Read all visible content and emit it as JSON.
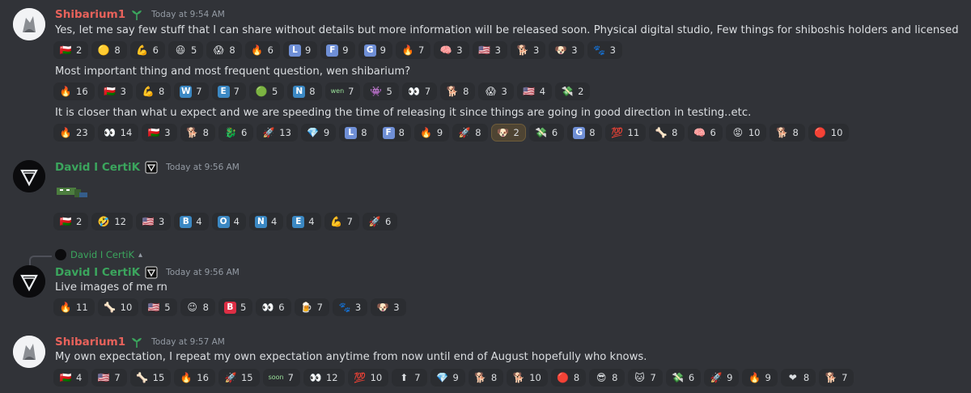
{
  "colors": {
    "background": "#313338",
    "shib_name": "#e8625b",
    "certik_name": "#3ba55d",
    "reaction_bg": "#2b2d31",
    "reaction_active": "#4e4433",
    "timestamp": "#949ba4"
  },
  "messages": [
    {
      "author": "Shibarium1",
      "timestamp": "Today at 9:54 AM",
      "blocks": [
        {
          "text": "Yes, let me say few stuff that I can share without details but more information will be released soon. Physical digital studio, Few things for shiboshis holders and licensed something.",
          "reactions": [
            {
              "icon": "flag-oman",
              "emoji": "🇴🇲",
              "count": "2"
            },
            {
              "icon": "yellow-circle",
              "emoji": "🟡",
              "count": "8"
            },
            {
              "icon": "muscle",
              "emoji": "💪",
              "count": "6"
            },
            {
              "icon": "laugh",
              "emoji": "😆",
              "count": "5"
            },
            {
              "icon": "scream",
              "emoji": "😱",
              "count": "8"
            },
            {
              "icon": "fire-hand",
              "emoji": "🔥",
              "count": "6"
            },
            {
              "icon": "letter-l",
              "letter": "L",
              "count": "9"
            },
            {
              "icon": "letter-f",
              "letter": "F",
              "count": "9"
            },
            {
              "icon": "letter-g",
              "letter": "G",
              "count": "9"
            },
            {
              "icon": "fire",
              "emoji": "🔥",
              "count": "7"
            },
            {
              "icon": "brain",
              "emoji": "🧠",
              "count": "3"
            },
            {
              "icon": "flag-us",
              "emoji": "🇺🇸",
              "count": "3"
            },
            {
              "icon": "shiba-face",
              "emoji": "🐕",
              "count": "3"
            },
            {
              "icon": "doge-face",
              "emoji": "🐶",
              "count": "3"
            },
            {
              "icon": "shiba-custom",
              "emoji": "🐾",
              "count": "3"
            }
          ]
        },
        {
          "text": "Most important thing and most frequent question, wen shibarium?",
          "reactions": [
            {
              "icon": "fire",
              "emoji": "🔥",
              "count": "16"
            },
            {
              "icon": "flag-oman",
              "emoji": "🇴🇲",
              "count": "3"
            },
            {
              "icon": "muscle",
              "emoji": "💪",
              "count": "8"
            },
            {
              "icon": "letter-w",
              "letter": "W",
              "count": "7"
            },
            {
              "icon": "letter-e",
              "letter": "E",
              "count": "7"
            },
            {
              "icon": "green-blob",
              "emoji": "🟢",
              "count": "5"
            },
            {
              "icon": "letter-n",
              "letter": "N",
              "count": "8"
            },
            {
              "icon": "wen-custom",
              "wen": "wen",
              "count": "7"
            },
            {
              "icon": "robot-custom",
              "emoji": "👾",
              "count": "5"
            },
            {
              "icon": "eyes",
              "emoji": "👀",
              "count": "7"
            },
            {
              "icon": "shiba-custom",
              "emoji": "🐕",
              "count": "8"
            },
            {
              "icon": "scream",
              "emoji": "😱",
              "count": "3"
            },
            {
              "icon": "flag-us",
              "emoji": "🇺🇸",
              "count": "4"
            },
            {
              "icon": "money-custom",
              "emoji": "💸",
              "count": "2"
            }
          ]
        },
        {
          "text": "It is closer than what u expect and we are speeding the time of releasing it since things are going in good direction in testing..etc.",
          "reactions": [
            {
              "icon": "fire-hand",
              "emoji": "🔥",
              "count": "23"
            },
            {
              "icon": "eyes",
              "emoji": "👀",
              "count": "14"
            },
            {
              "icon": "flag-oman",
              "emoji": "🇴🇲",
              "count": "3"
            },
            {
              "icon": "shiba-custom",
              "emoji": "🐕",
              "count": "8"
            },
            {
              "icon": "dragon-custom",
              "emoji": "🐉",
              "count": "6"
            },
            {
              "icon": "rocket",
              "emoji": "🚀",
              "count": "13"
            },
            {
              "icon": "gem",
              "emoji": "💎",
              "count": "9"
            },
            {
              "icon": "letter-l",
              "letter": "L",
              "count": "8"
            },
            {
              "icon": "letter-f",
              "letter": "F",
              "count": "8"
            },
            {
              "icon": "fire",
              "emoji": "🔥",
              "count": "9"
            },
            {
              "icon": "rocket-green",
              "emoji": "🚀",
              "count": "8"
            },
            {
              "icon": "shiba-king",
              "emoji": "🐶",
              "count": "2",
              "active": true
            },
            {
              "icon": "money-custom",
              "emoji": "💸",
              "count": "6"
            },
            {
              "icon": "letter-g",
              "letter": "G",
              "count": "8"
            },
            {
              "icon": "hundred",
              "emoji": "💯",
              "count": "11"
            },
            {
              "icon": "bone",
              "emoji": "🦴",
              "count": "8"
            },
            {
              "icon": "brain",
              "emoji": "🧠",
              "count": "6"
            },
            {
              "icon": "red-face",
              "emoji": "😡",
              "count": "10"
            },
            {
              "icon": "shiba-red",
              "emoji": "🐕",
              "count": "8"
            },
            {
              "icon": "red-token",
              "emoji": "🔴",
              "count": "10"
            }
          ]
        }
      ]
    },
    {
      "author": "David I CertiK",
      "timestamp": "Today at 9:56 AM",
      "reactions": [
        {
          "icon": "flag-oman",
          "emoji": "🇴🇲",
          "count": "2"
        },
        {
          "icon": "rofl",
          "emoji": "🤣",
          "count": "12"
        },
        {
          "icon": "flag-us",
          "emoji": "🇺🇸",
          "count": "3"
        },
        {
          "icon": "letter-b",
          "letter": "B",
          "count": "4"
        },
        {
          "icon": "letter-o",
          "letter": "O",
          "count": "4"
        },
        {
          "icon": "letter-n",
          "letter": "N",
          "count": "4"
        },
        {
          "icon": "letter-e",
          "letter": "E",
          "count": "4"
        },
        {
          "icon": "muscle",
          "emoji": "💪",
          "count": "7"
        },
        {
          "icon": "rocket-green",
          "emoji": "🚀",
          "count": "6"
        }
      ]
    },
    {
      "reply_to": "David I CertiK",
      "author": "David I CertiK",
      "timestamp": "Today at 9:56 AM",
      "text": "Live images of me rn",
      "reactions": [
        {
          "icon": "fire",
          "emoji": "🔥",
          "count": "11"
        },
        {
          "icon": "bone",
          "emoji": "🦴",
          "count": "10"
        },
        {
          "icon": "flag-us",
          "emoji": "🇺🇸",
          "count": "5"
        },
        {
          "icon": "wink",
          "emoji": "😉",
          "count": "8"
        },
        {
          "icon": "letter-b-red",
          "letter": "B",
          "count": "5"
        },
        {
          "icon": "eyes",
          "emoji": "👀",
          "count": "6"
        },
        {
          "icon": "beer",
          "emoji": "🍺",
          "count": "7"
        },
        {
          "icon": "shiba-custom",
          "emoji": "🐾",
          "count": "3"
        },
        {
          "icon": "doge-face",
          "emoji": "🐶",
          "count": "3"
        }
      ]
    },
    {
      "author": "Shibarium1",
      "timestamp": "Today at 9:57 AM",
      "text": "My own expectation, I repeat my own expectation anytime from now until end of August hopefully who knows.",
      "reactions": [
        {
          "icon": "flag-oman",
          "emoji": "🇴🇲",
          "count": "4"
        },
        {
          "icon": "flag-us",
          "emoji": "🇺🇸",
          "count": "7"
        },
        {
          "icon": "bone",
          "emoji": "🦴",
          "count": "15"
        },
        {
          "icon": "fire-hand",
          "emoji": "🔥",
          "count": "16"
        },
        {
          "icon": "rocket-green",
          "emoji": "🚀",
          "count": "15"
        },
        {
          "icon": "soon-custom",
          "wen": "soon",
          "count": "7"
        },
        {
          "icon": "eyes",
          "emoji": "👀",
          "count": "12"
        },
        {
          "icon": "hundred",
          "emoji": "💯",
          "count": "10"
        },
        {
          "icon": "arrow-up-green",
          "emoji": "⬆",
          "count": "7"
        },
        {
          "icon": "gem",
          "emoji": "💎",
          "count": "9"
        },
        {
          "icon": "shiba-custom",
          "emoji": "🐕",
          "count": "8"
        },
        {
          "icon": "shiba-red",
          "emoji": "🐕",
          "count": "10"
        },
        {
          "icon": "red-token",
          "emoji": "🔴",
          "count": "8"
        },
        {
          "icon": "sunglasses",
          "emoji": "😎",
          "count": "8"
        },
        {
          "icon": "cat-face",
          "emoji": "🐱",
          "count": "7"
        },
        {
          "icon": "money-custom",
          "emoji": "💸",
          "count": "6"
        },
        {
          "icon": "rocket",
          "emoji": "🚀",
          "count": "9"
        },
        {
          "icon": "fire",
          "emoji": "🔥",
          "count": "9"
        },
        {
          "icon": "heart",
          "emoji": "❤",
          "count": "8"
        },
        {
          "icon": "shiba-face",
          "emoji": "🐕",
          "count": "7"
        }
      ]
    }
  ]
}
